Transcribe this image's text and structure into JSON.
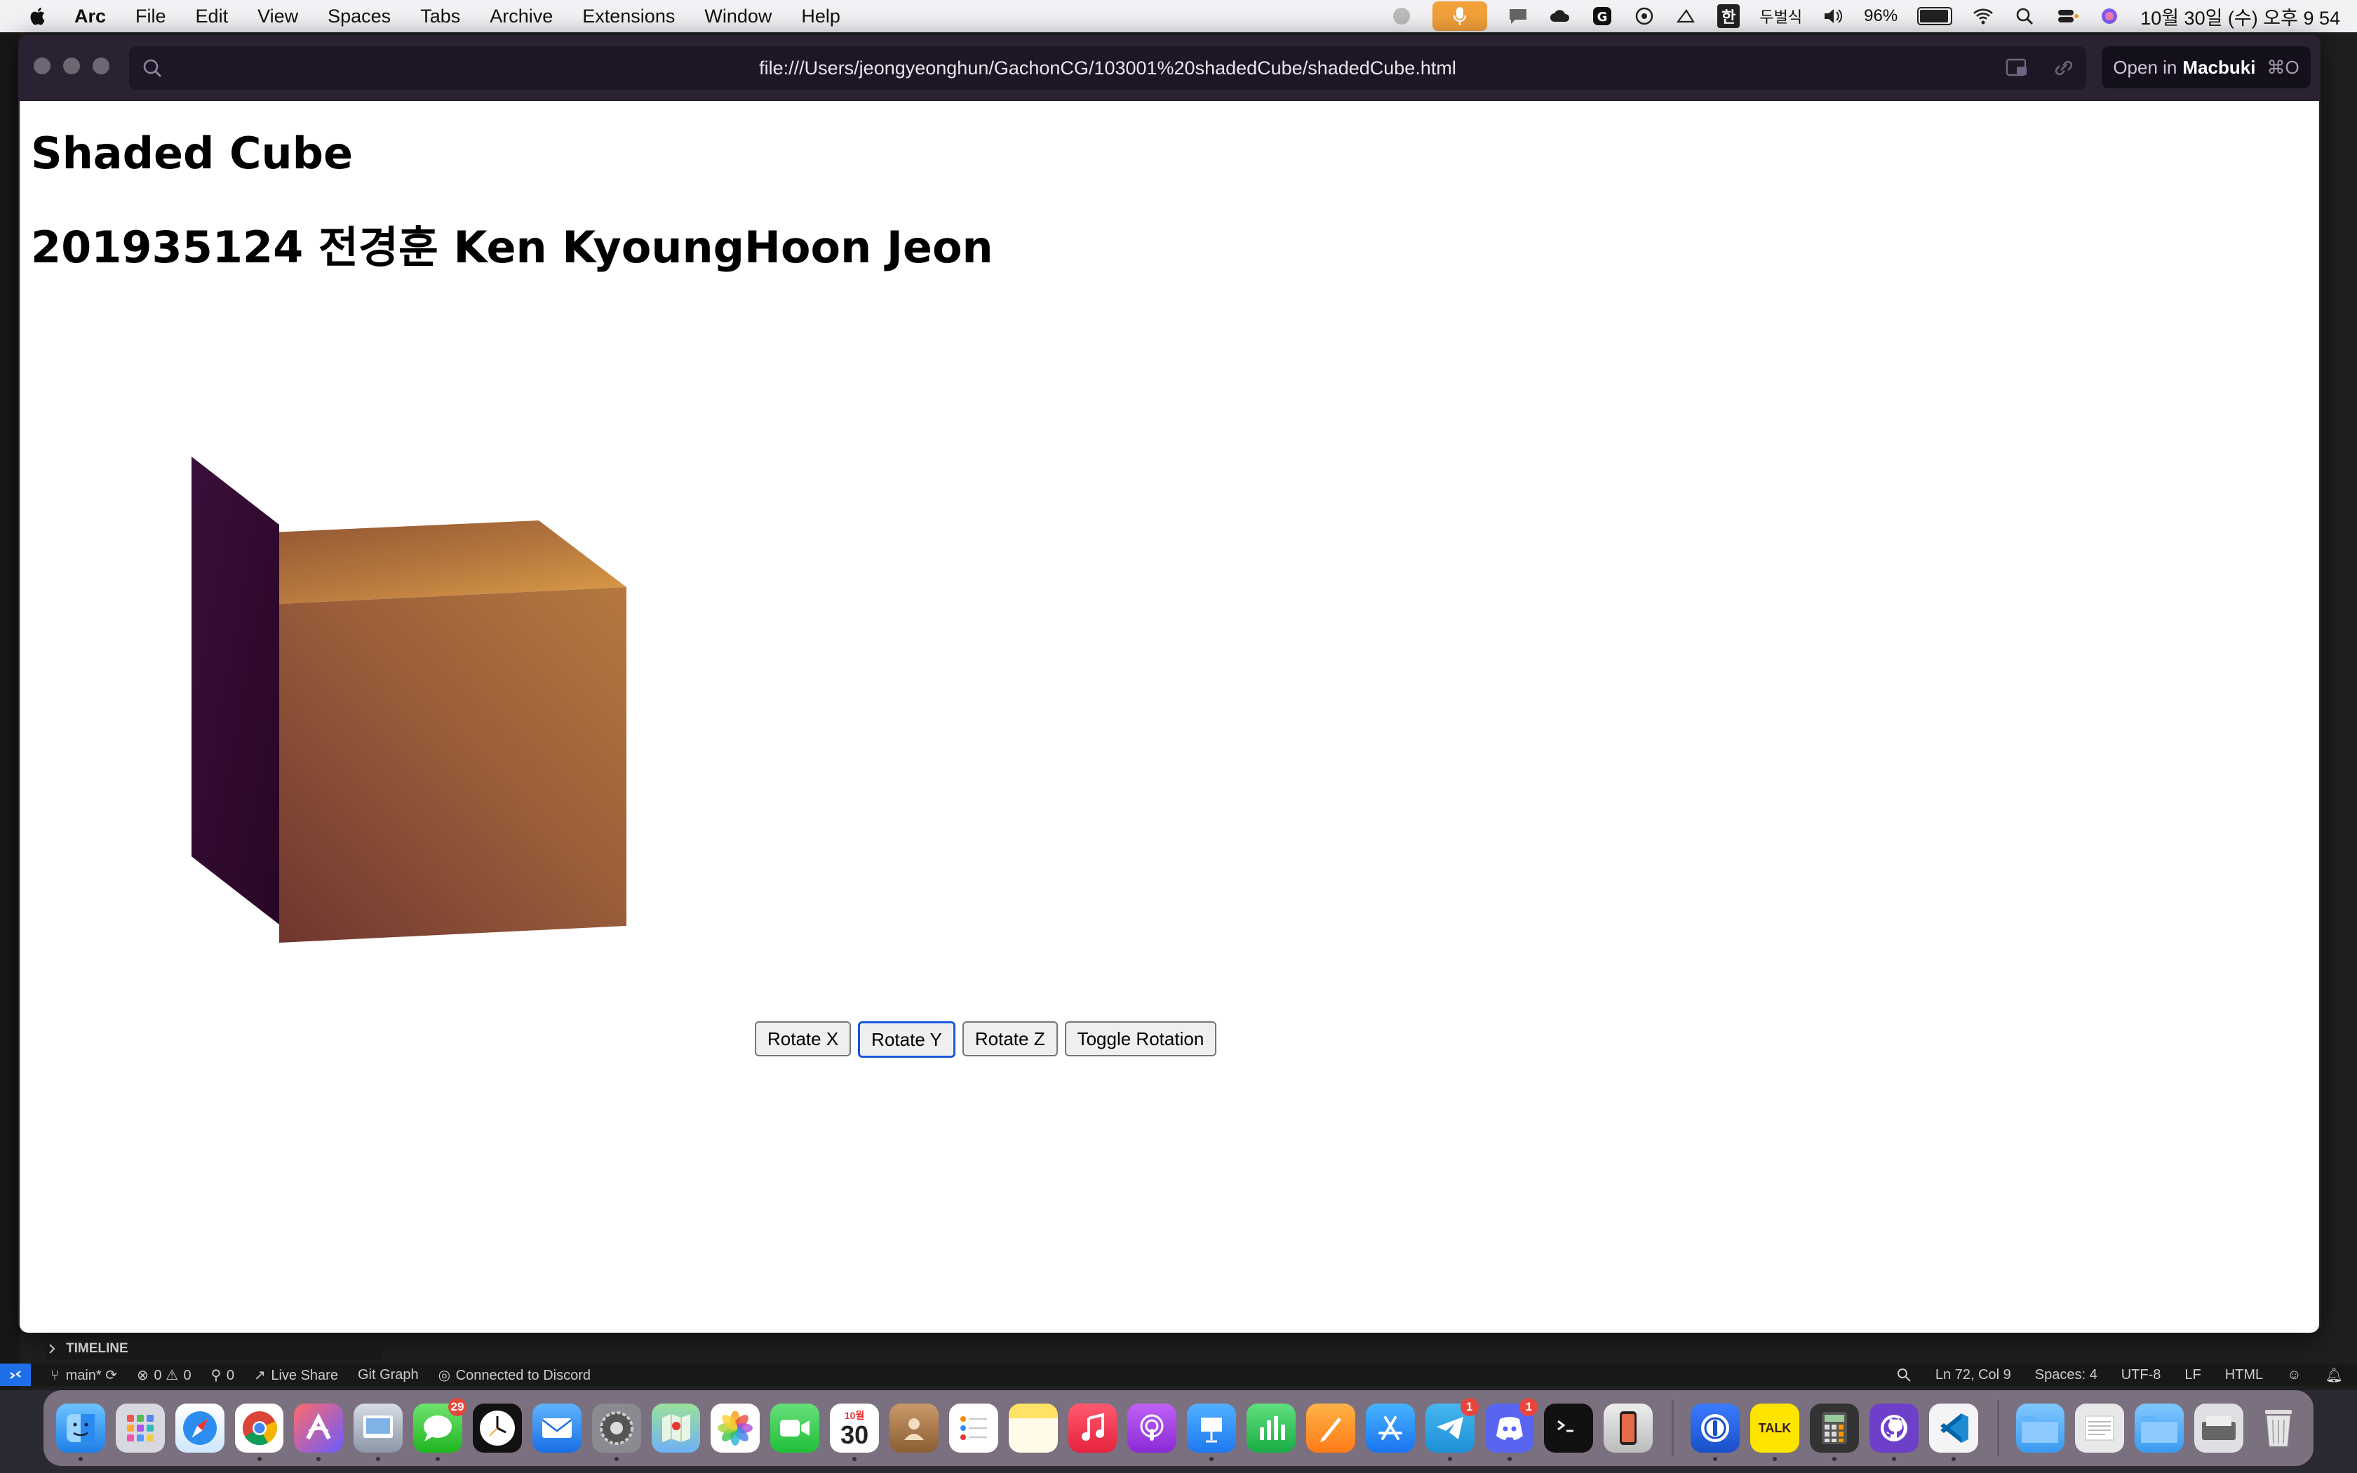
{
  "menubar": {
    "app_name": "Arc",
    "menus": [
      "File",
      "Edit",
      "View",
      "Spaces",
      "Tabs",
      "Archive",
      "Extensions",
      "Window",
      "Help"
    ],
    "ime_label": "한",
    "input_method": "두벌식",
    "battery": "96%",
    "battery_level": 0.96,
    "clock": "10월 30일 (수) 오후 9 54"
  },
  "browser": {
    "url": "file:///Users/jeongyeonghun/GachonCG/103001%20shadedCube/shadedCube.html",
    "open_in_label": "Open in",
    "open_in_app": "Macbuki",
    "open_in_shortcut": "⌘O"
  },
  "page": {
    "heading1": "Shaded Cube",
    "heading2": "201935124 전경훈 Ken KyoungHoon Jeon",
    "buttons": [
      "Rotate X",
      "Rotate Y",
      "Rotate Z",
      "Toggle Rotation"
    ]
  },
  "vscode": {
    "timeline": "TIMELINE",
    "branch": "main*",
    "errors": "0",
    "warnings": "0",
    "ports": "0",
    "live_share": "Live Share",
    "git_graph": "Git Graph",
    "discord": "Connected to Discord",
    "cursor": "Ln 72, Col 9",
    "spaces": "Spaces: 4",
    "encoding": "UTF-8",
    "eol": "LF",
    "language": "HTML"
  },
  "dock": {
    "messages_badge": "29",
    "calendar_month": "10월",
    "calendar_day": "30",
    "telegram_badge": "1",
    "discord_badge": "1",
    "talk_label": "TALK"
  }
}
